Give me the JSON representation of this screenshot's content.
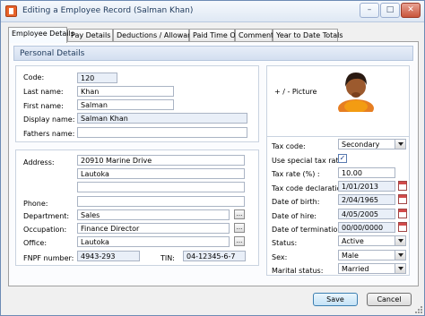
{
  "window": {
    "title": "Editing a Employee Record  (Salman Khan)",
    "controls": {
      "minimize": "–",
      "maximize": "□",
      "close": "✕"
    }
  },
  "tabs": [
    {
      "label": "Employee Details",
      "active": true
    },
    {
      "label": "Pay Details"
    },
    {
      "label": "Deductions / Allowance"
    },
    {
      "label": "Paid Time Off"
    },
    {
      "label": "Comments"
    },
    {
      "label": "Year to Date Totals"
    }
  ],
  "section": {
    "title": "Personal Details"
  },
  "personal": {
    "code_label": "Code:",
    "code": "120",
    "last_name_label": "Last name:",
    "last_name": "Khan",
    "first_name_label": "First name:",
    "first_name": "Salman",
    "display_name_label": "Display name:",
    "display_name": "Salman Khan",
    "fathers_name_label": "Fathers name:",
    "fathers_name": ""
  },
  "picture": {
    "label": "+ / - Picture"
  },
  "address": {
    "label": "Address:",
    "line1": "20910 Marine Drive",
    "line2": "Lautoka",
    "line3": "",
    "phone_label": "Phone:",
    "phone": "",
    "department_label": "Department:",
    "department": "Sales",
    "occupation_label": "Occupation:",
    "occupation": "Finance Director",
    "office_label": "Office:",
    "office": "Lautoka",
    "fnpf_label": "FNPF number:",
    "fnpf": "4943-293",
    "tin_label": "TIN:",
    "tin": "04-12345-6-7",
    "browse": "..."
  },
  "tax": {
    "tax_code_label": "Tax code:",
    "tax_code": "Secondary",
    "special_rate_label": "Use special tax rate:",
    "special_rate_checked": true,
    "check_mark": "✓",
    "tax_rate_label": "Tax rate (%) :",
    "tax_rate": "10.00",
    "tax_code_declaration_label": "Tax code declaration:",
    "tax_code_declaration": "1/01/2013",
    "dob_label": "Date of birth:",
    "dob": "2/04/1965",
    "hire_label": "Date of hire:",
    "hire": "4/05/2005",
    "termination_label": "Date of termination:",
    "termination": "00/00/0000",
    "status_label": "Status:",
    "status": "Active",
    "sex_label": "Sex:",
    "sex": "Male",
    "marital_label": "Marital status:",
    "marital": "Married"
  },
  "buttons": {
    "save": "Save",
    "cancel": "Cancel"
  },
  "colors": {
    "title_text": "#1e395b",
    "active_tab": "#f7fbff",
    "readonly_field": "#e9eff8"
  }
}
